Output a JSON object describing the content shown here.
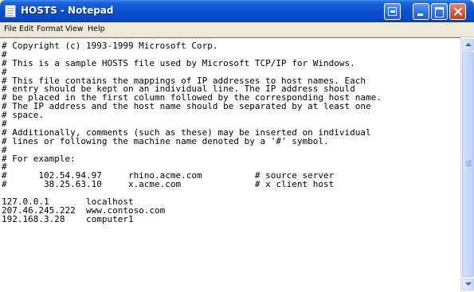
{
  "window": {
    "title": "HOSTS - Notepad"
  },
  "menubar": {
    "items": [
      "File",
      "Edit",
      "Format",
      "View",
      "Help"
    ]
  },
  "editor": {
    "lines": [
      "# Copyright (c) 1993-1999 Microsoft Corp.",
      "#",
      "# This is a sample HOSTS file used by Microsoft TCP/IP for Windows.",
      "#",
      "# This file contains the mappings of IP addresses to host names. Each",
      "# entry should be kept on an individual line. The IP address should",
      "# be placed in the first column followed by the corresponding host name.",
      "# The IP address and the host name should be separated by at least one",
      "# space.",
      "#",
      "# Additionally, comments (such as these) may be inserted on individual",
      "# lines or following the machine name denoted by a '#' symbol.",
      "#",
      "# For example:",
      "#",
      "#      102.54.94.97     rhino.acme.com          # source server",
      "#       38.25.63.10     x.acme.com              # x client host",
      "",
      "127.0.0.1       localhost",
      "207.46.245.222  www.contoso.com",
      "192.168.3.28    computer1"
    ]
  }
}
